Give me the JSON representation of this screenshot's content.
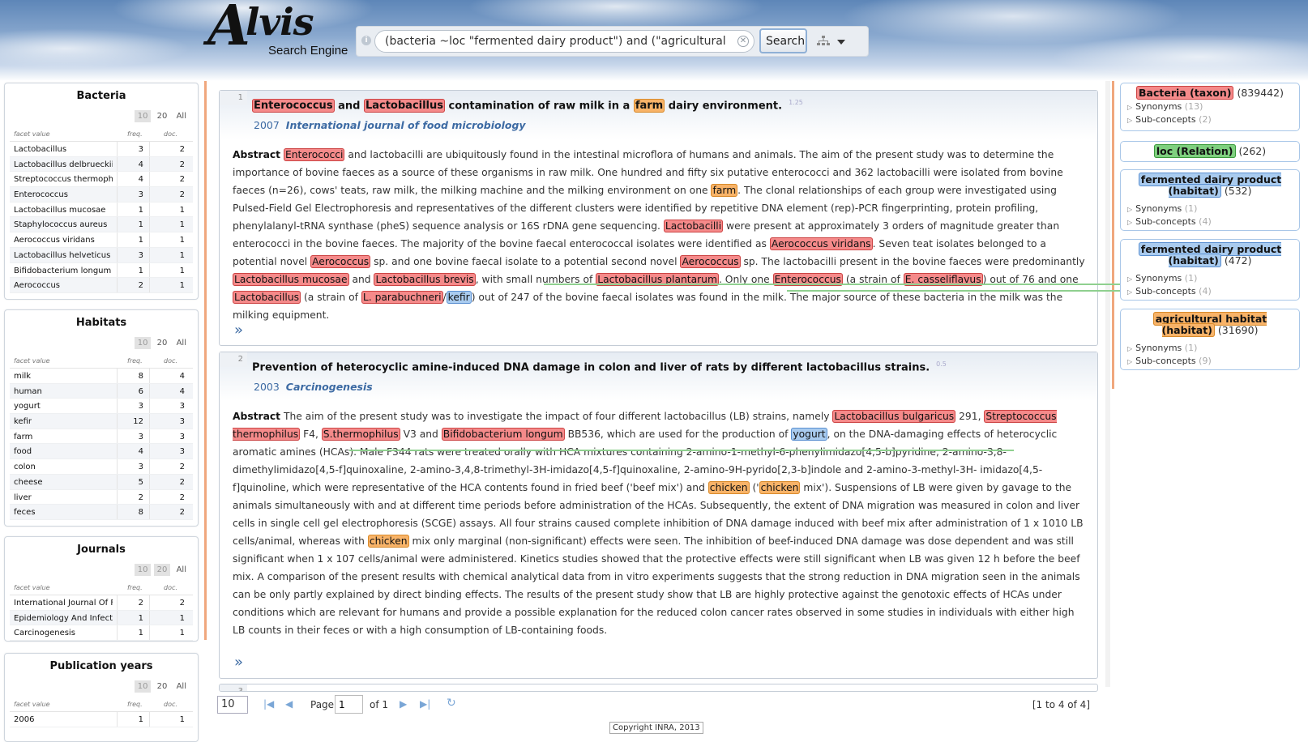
{
  "header": {
    "logo_initial": "A",
    "logo_rest": "lvis",
    "logo_subtitle": "Search Engine",
    "query": "(bacteria ~loc \"fermented dairy product\") and (\"agricultural habitat\")",
    "search_label": "Search",
    "info_glyph": "i",
    "clear_glyph": "✕",
    "icons": [
      "info-icon",
      "clear-icon",
      "sitemap-icon",
      "chevron-down-icon"
    ]
  },
  "facets": [
    {
      "title": "Bacteria",
      "sizes": [
        "10",
        "20",
        "All"
      ],
      "col_value": "facet value",
      "col_freq": "freq.",
      "col_doc": "doc.",
      "rows": [
        {
          "value": "Lactobacillus",
          "freq": "3",
          "doc": "2"
        },
        {
          "value": "Lactobacillus delbrueckii",
          "freq": "4",
          "doc": "2"
        },
        {
          "value": "Streptococcus thermophilus",
          "freq": "4",
          "doc": "2"
        },
        {
          "value": "Enterococcus",
          "freq": "3",
          "doc": "2"
        },
        {
          "value": "Lactobacillus mucosae",
          "freq": "1",
          "doc": "1"
        },
        {
          "value": "Staphylococcus aureus",
          "freq": "1",
          "doc": "1"
        },
        {
          "value": "Aerococcus viridans",
          "freq": "1",
          "doc": "1"
        },
        {
          "value": "Lactobacillus helveticus",
          "freq": "3",
          "doc": "1"
        },
        {
          "value": "Bifidobacterium longum",
          "freq": "1",
          "doc": "1"
        },
        {
          "value": "Aerococcus",
          "freq": "2",
          "doc": "1"
        }
      ]
    },
    {
      "title": "Habitats",
      "sizes": [
        "10",
        "20",
        "All"
      ],
      "col_value": "facet value",
      "col_freq": "freq.",
      "col_doc": "doc.",
      "rows": [
        {
          "value": "milk",
          "freq": "8",
          "doc": "4"
        },
        {
          "value": "human",
          "freq": "6",
          "doc": "4"
        },
        {
          "value": "yogurt",
          "freq": "3",
          "doc": "3"
        },
        {
          "value": "kefir",
          "freq": "12",
          "doc": "3"
        },
        {
          "value": "farm",
          "freq": "3",
          "doc": "3"
        },
        {
          "value": "food",
          "freq": "4",
          "doc": "3"
        },
        {
          "value": "colon",
          "freq": "3",
          "doc": "2"
        },
        {
          "value": "cheese",
          "freq": "5",
          "doc": "2"
        },
        {
          "value": "liver",
          "freq": "2",
          "doc": "2"
        },
        {
          "value": "feces",
          "freq": "8",
          "doc": "2"
        }
      ]
    },
    {
      "title": "Journals",
      "sizes": [
        "10",
        "20",
        "All"
      ],
      "col_value": "facet value",
      "col_freq": "freq.",
      "col_doc": "doc.",
      "rows": [
        {
          "value": "International Journal Of Food Microbiology",
          "freq": "2",
          "doc": "2"
        },
        {
          "value": "Epidemiology And Infection",
          "freq": "1",
          "doc": "1"
        },
        {
          "value": "Carcinogenesis",
          "freq": "1",
          "doc": "1"
        }
      ]
    },
    {
      "title": "Publication years",
      "sizes": [
        "10",
        "20",
        "All"
      ],
      "col_value": "facet value",
      "col_freq": "freq.",
      "col_doc": "doc.",
      "rows": [
        {
          "value": "2006",
          "freq": "1",
          "doc": "1"
        }
      ]
    }
  ],
  "documents": [
    {
      "num": "1",
      "title_parts": [
        {
          "t": "Enterococcus",
          "c": "bact"
        },
        {
          "t": " and "
        },
        {
          "t": "Lactobacillus",
          "c": "bact"
        },
        {
          "t": " contamination of raw milk in a "
        },
        {
          "t": "farm",
          "c": "hab"
        },
        {
          "t": " dairy environment."
        }
      ],
      "score": "1.25",
      "year": "2007",
      "journal": "International journal of food microbiology",
      "abstract_label": "Abstract",
      "abstract_parts": [
        {
          "t": " "
        },
        {
          "t": "Enterococci",
          "c": "bact"
        },
        {
          "t": " and lactobacilli are ubiquitously found in the intestinal microflora of humans and animals. The aim of the present study was to determine the importance of bovine faeces as a source of these organisms in raw milk. One hundred and fifty six putative enterococci and 362 lactobacilli were isolated from bovine faeces (n=26), cows' teats, raw milk, the milking machine and the milking environment on one "
        },
        {
          "t": "farm",
          "c": "hab"
        },
        {
          "t": ". The clonal relationships of each group were investigated using Pulsed-Field Gel Electrophoresis and representatives of the different clusters were identified by repetitive DNA element (rep)-PCR fingerprinting, protein profiling, phenylalanyl-tRNA synthase (pheS) sequence analysis or 16S rDNA gene sequencing. "
        },
        {
          "t": "Lactobacilli",
          "c": "bact"
        },
        {
          "t": " were present at approximately 3 orders of magnitude greater than enterococci in the bovine faeces. The majority of the bovine faecal enterococcal isolates were identified as "
        },
        {
          "t": "Aerococcus viridans",
          "c": "bact"
        },
        {
          "t": ". Seven teat isolates belonged to a potential novel "
        },
        {
          "t": "Aerococcus",
          "c": "bact"
        },
        {
          "t": " sp. and one bovine faecal isolate to a potential second novel "
        },
        {
          "t": "Aerococcus",
          "c": "bact"
        },
        {
          "t": " sp. The lactobacilli present in the bovine faeces were predominantly "
        },
        {
          "t": "Lactobacillus mucosae",
          "c": "bact"
        },
        {
          "t": " and "
        },
        {
          "t": "Lactobacillus brevis",
          "c": "bact"
        },
        {
          "t": ", with small numbers of "
        },
        {
          "t": "Lactobacillus plantarum",
          "c": "bact"
        },
        {
          "t": ". Only one "
        },
        {
          "t": "Enterococcus",
          "c": "bact"
        },
        {
          "t": " (a strain of "
        },
        {
          "t": "E. casseliflavus",
          "c": "bact"
        },
        {
          "t": ") out of 76 and one "
        },
        {
          "t": "Lactobacillus",
          "c": "bact"
        },
        {
          "t": " (a strain of "
        },
        {
          "t": "L. parabuchneri",
          "c": "bact"
        },
        {
          "t": "/"
        },
        {
          "t": "kefir",
          "c": "dairy"
        },
        {
          "t": ") out of 247 of the bovine faecal isolates was found in the milk. The major source of these bacteria in the milk was the milking equipment."
        }
      ]
    },
    {
      "num": "2",
      "title_parts": [
        {
          "t": "Prevention of heterocyclic amine-induced DNA damage in colon and liver of rats by different lactobacillus strains."
        }
      ],
      "score": "0.5",
      "year": "2003",
      "journal": "Carcinogenesis",
      "abstract_label": "Abstract",
      "abstract_parts": [
        {
          "t": " The aim of the present study was to investigate the impact of four different lactobacillus (LB) strains, namely "
        },
        {
          "t": "Lactobacillus bulgaricus",
          "c": "bact"
        },
        {
          "t": " 291, "
        },
        {
          "t": "Streptococcus thermophilus",
          "c": "bact"
        },
        {
          "t": " F4, "
        },
        {
          "t": "S.thermophilus",
          "c": "bact"
        },
        {
          "t": " V3 and "
        },
        {
          "t": "Bifidobacterium longum",
          "c": "bact"
        },
        {
          "t": " BB536, which are used for the production of "
        },
        {
          "t": "yogurt",
          "c": "dairy"
        },
        {
          "t": ", on the DNA-damaging effects of heterocyclic aromatic amines (HCAs). Male F344 rats were treated orally with HCA mixtures containing 2-amino-1-methyl-6-phenylimidazo[4,5-b]pyridine, 2-amino-3,8-dimethylimidazo[4,5-f]quinoxaline, 2-amino-3,4,8-trimethyl-3H-imidazo[4,5-f]quinoxaline, 2-amino-9H-pyrido[2,3-b]indole and 2-amino-3-methyl-3H- imidazo[4,5-f]quinoline, which were representative of the HCA contents found in fried beef ('beef mix') and "
        },
        {
          "t": "chicken",
          "c": "hab"
        },
        {
          "t": " ('"
        },
        {
          "t": "chicken",
          "c": "hab"
        },
        {
          "t": " mix'). Suspensions of LB were given by gavage to the animals simultaneously with and at different time periods before administration of the HCAs. Subsequently, the extent of DNA migration was measured in colon and liver cells in single cell gel electrophoresis (SCGE) assays. All four strains caused complete inhibition of DNA damage induced with beef mix after administration of 1 x 1010 LB cells/animal, whereas with "
        },
        {
          "t": "chicken",
          "c": "hab"
        },
        {
          "t": " mix only marginal (non-significant) effects were seen. The inhibition of beef-induced DNA damage was dose dependent and was still significant when 1 x 107 cells/animal were administered. Kinetics studies showed that the protective effects were still significant when LB was given 12 h before the beef mix. A comparison of the present results with chemical analytical data from in vitro experiments suggests that the strong reduction in DNA migration seen in the animals can be only partly explained by direct binding effects. The results of the present study show that LB are highly protective against the genotoxic effects of HCAs under conditions which are relevant for humans and provide a possible explanation for the reduced colon cancer rates observed in some studies in individuals with either high LB counts in their feces or with a high consumption of LB-containing foods."
        }
      ]
    },
    {
      "num": "3"
    }
  ],
  "expand_glyph": "»",
  "pager": {
    "page_size": "10",
    "page_label": "Page",
    "page_value": "1",
    "of_label": "of 1",
    "range": "[1 to 4 of 4]",
    "icons": [
      "first-page-icon",
      "prev-page-icon",
      "next-page-icon",
      "last-page-icon",
      "refresh-icon"
    ]
  },
  "copyright": "Copyright INRA, 2013",
  "query_terms": [
    {
      "label": "Bacteria (taxon)",
      "count": "(839442)",
      "color": "red",
      "synonyms": "Synonyms",
      "syn_count": "(13)",
      "subconcepts": "Sub-concepts",
      "sub_count": "(2)"
    },
    {
      "label": "loc (Relation)",
      "count": "(262)",
      "color": "green"
    },
    {
      "label": "fermented dairy product (habitat)",
      "count": "(532)",
      "color": "blue",
      "synonyms": "Synonyms",
      "syn_count": "(1)",
      "subconcepts": "Sub-concepts",
      "sub_count": "(4)"
    },
    {
      "label": "fermented dairy product (habitat)",
      "count": "(472)",
      "color": "blue",
      "synonyms": "Synonyms",
      "syn_count": "(1)",
      "subconcepts": "Sub-concepts",
      "sub_count": "(4)"
    },
    {
      "label": "agricultural habitat (habitat)",
      "count": "(31690)",
      "color": "orange",
      "synonyms": "Synonyms",
      "syn_count": "(1)",
      "subconcepts": "Sub-concepts",
      "sub_count": "(9)"
    }
  ],
  "colors": {
    "bacteria": "#f58a8a",
    "habitat": "#f8b368",
    "dairy": "#a9cbef",
    "relation": "#7fd07f",
    "link": "#3c6aa3",
    "splitter": "#f0a77d"
  }
}
